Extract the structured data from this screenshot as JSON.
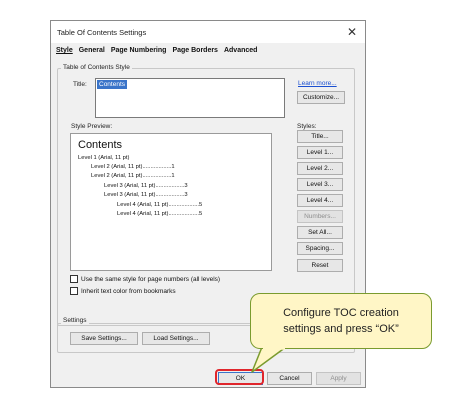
{
  "dialog": {
    "title": "Table Of Contents Settings",
    "close_glyph": "✕",
    "tabs": [
      "Style",
      "General",
      "Page Numbering",
      "Page Borders",
      "Advanced"
    ],
    "active_tab": "Style"
  },
  "toc_style": {
    "group_label": "Table of Contents Style",
    "title_label": "Title:",
    "title_value": "Contents",
    "learn_more": "Learn more...",
    "customize": "Customize..."
  },
  "preview": {
    "label": "Style Preview:",
    "heading": "Contents",
    "lines": [
      "Level 1 (Arial, 11 pt)",
      "Level 2 (Arial, 11 pt)..................1",
      "Level 2 (Arial, 11 pt)..................1",
      "Level 3 (Arial, 11 pt)..................3",
      "Level 3 (Arial, 11 pt)..................3",
      "Level 4 (Arial, 11 pt)...................5",
      "Level 4 (Arial, 11 pt)...................5"
    ]
  },
  "styles": {
    "label": "Styles:",
    "buttons": [
      "Title...",
      "Level 1...",
      "Level 2...",
      "Level 3...",
      "Level 4...",
      "Numbers...",
      "Set All...",
      "Spacing...",
      "Reset"
    ],
    "disabled": [
      "Numbers..."
    ]
  },
  "options": {
    "same_style": "Use the same style for page numbers (all levels)",
    "inherit_color": "Inherit text color from bookmarks"
  },
  "settings": {
    "group_label": "Settings",
    "save": "Save Settings...",
    "load": "Load Settings..."
  },
  "footer": {
    "ok": "OK",
    "cancel": "Cancel",
    "apply": "Apply"
  },
  "callout": {
    "line1": "Configure TOC creation",
    "line2": "settings and press “OK”"
  },
  "colors": {
    "highlight": "#e0262c",
    "callout_fill": "#fff6c6",
    "callout_border": "#7a9b2e",
    "selection": "#3a74c9",
    "link": "#1a4fd1"
  }
}
